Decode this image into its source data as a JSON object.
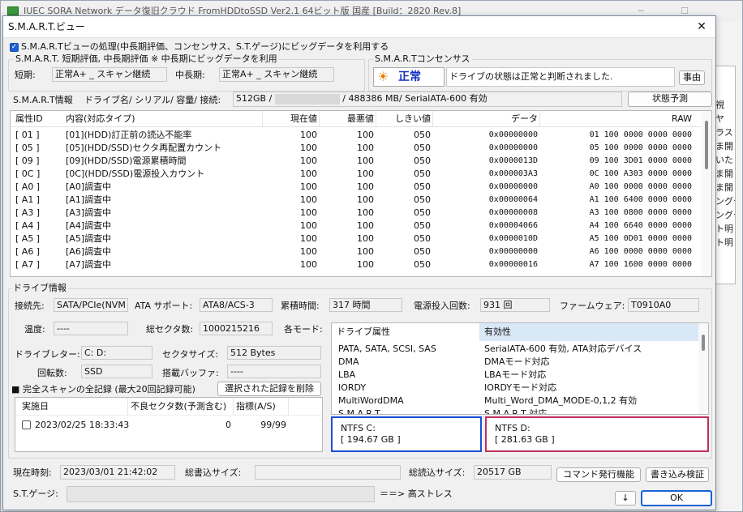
{
  "bg_window": {
    "title": "IUEC SORA Network データ復旧クラウド FromHDDtoSSD Ver2.1 64ビット版 国産 [Build：2820 Rev.8]",
    "right_fragments": [
      "視",
      "ヤ",
      "ラスし",
      "ま開",
      "いた",
      "ま開",
      "ま開",
      "ングデ",
      "ングデ",
      "ト明",
      "ト明"
    ]
  },
  "dialog": {
    "title": "S.M.A.R.T.ビュー",
    "close_glyph": "✕",
    "bigdata_checkbox_label": "S.M.A.R.Tビューの処理(中長期評価、コンセンサス、S.T.ゲージ)にビッグデータを利用する",
    "eval_group": {
      "title": "S.M.A.R.T. 短期評価, 中長期評価 ※ 中長期にビッグデータを利用",
      "short_label": "短期:",
      "short_value": "正常A+ _ スキャン継続",
      "mid_label": "中長期:",
      "mid_value": "正常A+ _ スキャン継続"
    },
    "consensus_group": {
      "title": "S.M.A.R.Tコンセンサス",
      "status_icon": "☀",
      "status": "正常",
      "message": "ドライブの状態は正常と判断されました.",
      "reason_button": "事由"
    },
    "smart_info": {
      "label": "S.M.A.R.T情報",
      "drive_label": "ドライブ名/ シリアル/ 容量/ 接続:",
      "drive_name": "512GB /",
      "drive_rest": "/ 488386 MB/ SerialATA-600 有効",
      "predict_button": "状態予測"
    },
    "smart_table": {
      "headers": [
        "属性ID",
        "内容(対応タイプ)",
        "現在値",
        "最悪値",
        "しきい値",
        "データ",
        "RAW"
      ],
      "rows": [
        [
          "[ 01 ]",
          "[01](HDD)訂正前の読込不能率",
          "100",
          "100",
          "050",
          "0x00000000",
          "01 100 0000 0000 0000"
        ],
        [
          "[ 05 ]",
          "[05](HDD/SSD)セクタ再配置カウント",
          "100",
          "100",
          "050",
          "0x00000000",
          "05 100 0000 0000 0000"
        ],
        [
          "[ 09 ]",
          "[09](HDD/SSD)電源累積時間",
          "100",
          "100",
          "050",
          "0x0000013D",
          "09 100 3D01 0000 0000"
        ],
        [
          "[ 0C ]",
          "[0C](HDD/SSD)電源投入カウント",
          "100",
          "100",
          "050",
          "0x000003A3",
          "0C 100 A303 0000 0000"
        ],
        [
          "[ A0 ]",
          "[A0]調査中",
          "100",
          "100",
          "050",
          "0x00000000",
          "A0 100 0000 0000 0000"
        ],
        [
          "[ A1 ]",
          "[A1]調査中",
          "100",
          "100",
          "050",
          "0x00000064",
          "A1 100 6400 0000 0000"
        ],
        [
          "[ A3 ]",
          "[A3]調査中",
          "100",
          "100",
          "050",
          "0x00000008",
          "A3 100 0800 0000 0000"
        ],
        [
          "[ A4 ]",
          "[A4]調査中",
          "100",
          "100",
          "050",
          "0x00004066",
          "A4 100 6640 0000 0000"
        ],
        [
          "[ A5 ]",
          "[A5]調査中",
          "100",
          "100",
          "050",
          "0x0000010D",
          "A5 100 0D01 0000 0000"
        ],
        [
          "[ A6 ]",
          "[A6]調査中",
          "100",
          "100",
          "050",
          "0x00000000",
          "A6 100 0000 0000 0000"
        ],
        [
          "[ A7 ]",
          "[A7]調査中",
          "100",
          "100",
          "050",
          "0x00000016",
          "A7 100 1600 0000 0000"
        ]
      ]
    },
    "drive_info": {
      "title": "ドライブ情報",
      "conn_label": "接続先:",
      "conn_value": "SATA/PCIe(NVM",
      "ata_label": "ATA サポート:",
      "ata_value": "ATA8/ACS-3",
      "hours_label": "累積時間:",
      "hours_value": "317 時間",
      "power_label": "電源投入回数:",
      "power_value": "931 回",
      "fw_label": "ファームウェア:",
      "fw_value": "T0910A0",
      "temp_label": "温度:",
      "temp_value": "----",
      "sectors_label": "総セクタ数:",
      "sectors_value": "1000215216",
      "mode_label": "各モード:",
      "letter_label": "ドライブレター:",
      "letter_value": "C: D:",
      "sector_size_label": "セクタサイズ:",
      "sector_size_value": "512 Bytes",
      "rpm_label": "回転数:",
      "rpm_value": "SSD",
      "buffer_label": "搭載バッファ:",
      "buffer_value": "----"
    },
    "modes_table": {
      "headers": [
        "ドライブ属性",
        "有効性"
      ],
      "rows": [
        [
          "PATA, SATA, SCSI, SAS",
          "SerialATA-600 有効, ATA対応デバイス"
        ],
        [
          "DMA",
          "DMAモード対応"
        ],
        [
          "LBA",
          "LBAモード対応"
        ],
        [
          "IORDY",
          "IORDYモード対応"
        ],
        [
          "MultiWordDMA",
          "Multi_Word_DMA_MODE-0,1,2 有効"
        ],
        [
          "S.M.A.R.T",
          "S.M.A.R.T 対応"
        ]
      ]
    },
    "partitions": [
      {
        "name": "NTFS C:",
        "size": "[ 194.67 GB ]",
        "color": "#1a4fd8"
      },
      {
        "name": "NTFS D:",
        "size": "[ 281.63 GB ]",
        "color": "#c0305a"
      }
    ],
    "scan_log": {
      "title": "■ 完全スキャンの全記録 (最大20回記録可能)",
      "delete_button": "選択された記録を削除",
      "headers": [
        "実施日",
        "不良セクタ数(予測含む)",
        "指標(A/S)"
      ],
      "rows": [
        {
          "date": "2023/02/25 18:33:43",
          "bad": "0",
          "index": "99/99"
        }
      ]
    },
    "footer": {
      "now_label": "現在時刻:",
      "now_value": "2023/03/01 21:42:02",
      "write_label": "総書込サイズ:",
      "write_value": "",
      "read_label": "総読込サイズ:",
      "read_value": "20517 GB",
      "cmd_button": "コマンド発行機能",
      "verify_button": "書き込み検証",
      "gauge_label": "S.T.ゲージ:",
      "gauge_suffix": "＝＝> 高ストレス",
      "down_button": "↓",
      "ok_button": "OK"
    }
  }
}
